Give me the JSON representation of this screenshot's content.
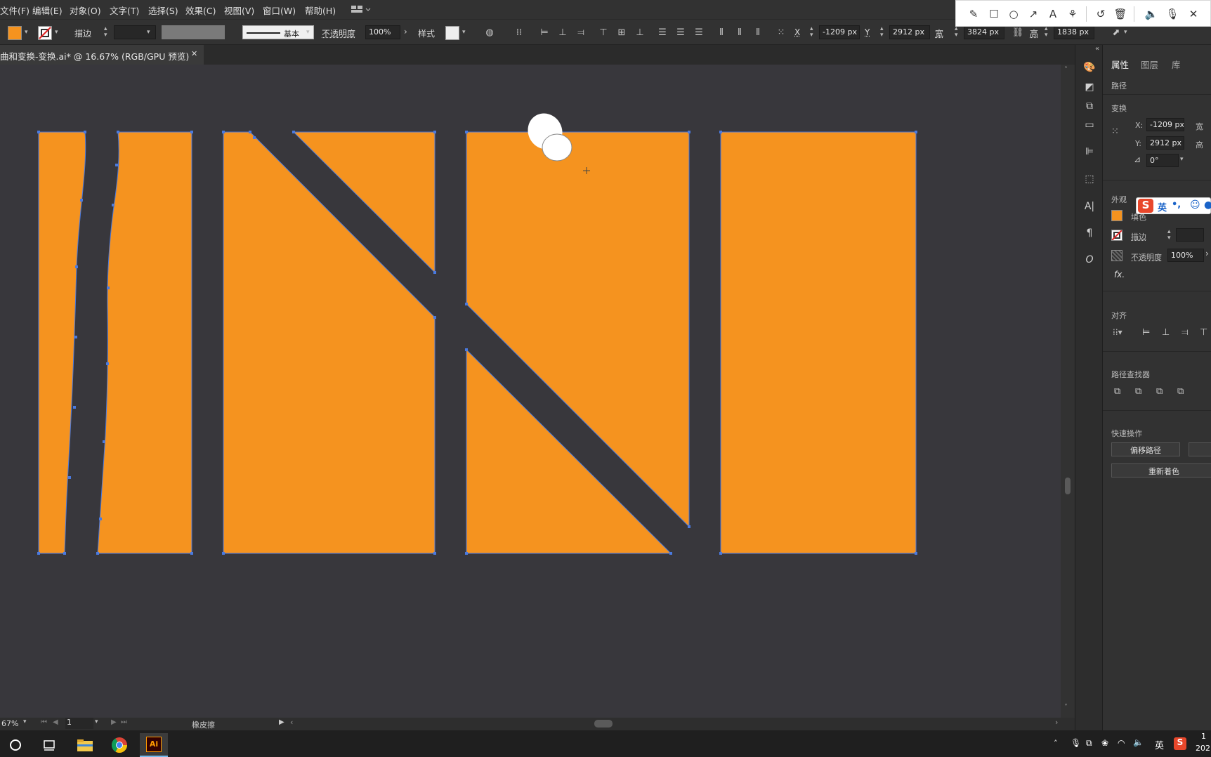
{
  "menubar": {
    "items": [
      "文件(F)",
      "编辑(E)",
      "对象(O)",
      "文字(T)",
      "选择(S)",
      "效果(C)",
      "视图(V)",
      "窗口(W)",
      "帮助(H)"
    ]
  },
  "controlbar": {
    "fill_color": "#f5931f",
    "stroke_label": "描边",
    "stroke_style": "基本",
    "opacity_label": "不透明度",
    "opacity_value": "100%",
    "style_label": "样式",
    "x_label": "X",
    "x_value": "-1209 px",
    "y_label": "Y",
    "y_value": "2912 px",
    "w_label": "宽",
    "w_value": "3824 px",
    "h_label": "高",
    "h_value": "1838 px"
  },
  "document": {
    "tab_title": "曲和变换-变换.ai* @ 16.67% (RGB/GPU 预览)",
    "close_glyph": "✕",
    "shape_fill": "#f5931f",
    "selection_color": "#4a7ae0"
  },
  "statusbar": {
    "zoom": "67%",
    "artboard": "1",
    "tool_name": "橡皮擦"
  },
  "right_panel": {
    "tabs": [
      "属性",
      "图层",
      "库"
    ],
    "object_type": "路径",
    "transform_title": "变换",
    "x_label": "X:",
    "x_value": "-1209 px",
    "y_label": "Y:",
    "y_value": "2912 px",
    "w_label": "宽",
    "h_label": "高",
    "angle_value": "0°",
    "appearance_title": "外观",
    "fill_label": "填色",
    "stroke_label": "描边",
    "opacity_label": "不透明度",
    "opacity_value": "100%",
    "fx_label": "fx.",
    "align_title": "对齐",
    "pathfinder_title": "路径查找器",
    "quick_actions_title": "快速操作",
    "offset_path_button": "偏移路径",
    "recolor_button": "重新着色"
  },
  "ime": {
    "mode": "英",
    "punct": "•,"
  },
  "taskbar": {
    "ime_indicator": "英",
    "clock_partial": "1",
    "date_partial": "202",
    "ai_label": "Ai"
  }
}
